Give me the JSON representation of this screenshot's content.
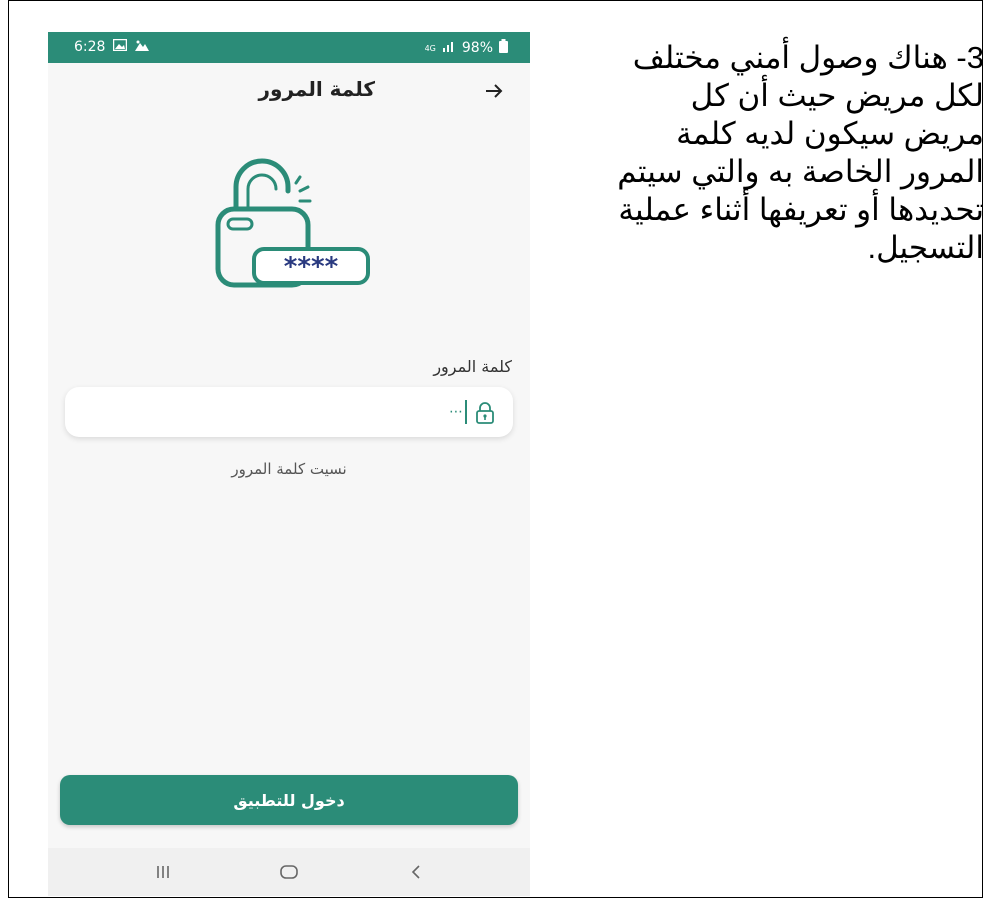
{
  "status_bar": {
    "time": "6:28",
    "battery": "98%",
    "network": "4G"
  },
  "app_bar": {
    "title": "كلمة المرور"
  },
  "form": {
    "label": "كلمة المرور",
    "password_value": "",
    "forgot_link": "نسيت كلمة المرور"
  },
  "login_button": {
    "label": "دخول للتطبيق"
  },
  "illustration": {
    "mask_text": "****"
  },
  "description": {
    "lines": [
      "3- هناك وصول أمني مختلف",
      "لكل مريض حيث أن كل",
      "مريض سيكون لديه كلمة",
      "المرور الخاصة به والتي سيتم",
      "تحديدها أو تعريفها أثناء عملية",
      "التسجيل."
    ]
  },
  "colors": {
    "primary": "#2b8c78",
    "mask_text": "#2a3a80"
  }
}
